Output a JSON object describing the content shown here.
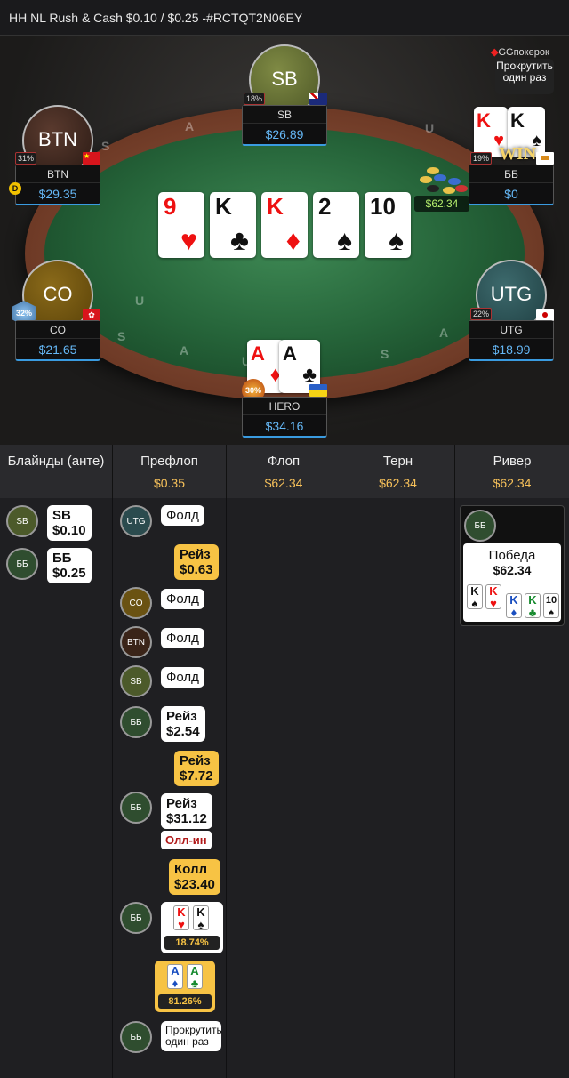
{
  "header": {
    "title": "HH NL Rush & Cash $0.10 / $0.25 -#RCTQT2N06EY"
  },
  "logo": {
    "brand": "GGпокерок"
  },
  "replay_button": {
    "label": "Прокрутить один раз"
  },
  "rail_letters": [
    "S",
    "A",
    "U",
    "S",
    "A",
    "U",
    "S",
    "A",
    "U"
  ],
  "players": {
    "sb": {
      "avatar": "SB",
      "name": "SB",
      "stack": "$26.89",
      "pct": "18%"
    },
    "btn": {
      "avatar": "BTN",
      "name": "BTN",
      "stack": "$29.35",
      "pct": "31%"
    },
    "bb": {
      "name": "ББ",
      "stack": "$0",
      "pct": "19%",
      "win": "WIN"
    },
    "co": {
      "avatar": "CO",
      "name": "CO",
      "stack": "$21.65",
      "pct": "32%"
    },
    "utg": {
      "avatar": "UTG",
      "name": "UTG",
      "stack": "$18.99",
      "pct": "22%"
    },
    "hero": {
      "name": "HERO",
      "stack": "$34.16",
      "pct": "30%"
    }
  },
  "dealer_button": "D",
  "pot": "$62.34",
  "board": [
    {
      "rank": "9",
      "suit": "♥",
      "color": "red"
    },
    {
      "rank": "K",
      "suit": "♣",
      "color": "black"
    },
    {
      "rank": "K",
      "suit": "♦",
      "color": "red"
    },
    {
      "rank": "2",
      "suit": "♠",
      "color": "black"
    },
    {
      "rank": "10",
      "suit": "♠",
      "color": "black"
    }
  ],
  "hero_cards": [
    {
      "rank": "A",
      "suit": "♦",
      "color": "red"
    },
    {
      "rank": "A",
      "suit": "♣",
      "color": "black"
    }
  ],
  "bb_cards": [
    {
      "rank": "K",
      "suit": "♥",
      "color": "red"
    },
    {
      "rank": "K",
      "suit": "♠",
      "color": "black"
    }
  ],
  "columns": [
    {
      "title": "Блайнды (анте)",
      "pot": ""
    },
    {
      "title": "Префлоп",
      "pot": "$0.35"
    },
    {
      "title": "Флоп",
      "pot": "$62.34"
    },
    {
      "title": "Терн",
      "pot": "$62.34"
    },
    {
      "title": "Ривер",
      "pot": "$62.34"
    }
  ],
  "blinds": [
    {
      "pos": "SB",
      "action": "SB",
      "amount": "$0.10"
    },
    {
      "pos": "ББ",
      "action": "ББ",
      "amount": "$0.25"
    }
  ],
  "preflop": {
    "a1": {
      "pos": "UTG",
      "action": "Фолд"
    },
    "a2": {
      "action": "Рейз",
      "amount": "$0.63"
    },
    "a3": {
      "pos": "CO",
      "action": "Фолд"
    },
    "a4": {
      "pos": "BTN",
      "action": "Фолд"
    },
    "a5": {
      "pos": "SB",
      "action": "Фолд"
    },
    "a6": {
      "pos": "ББ",
      "action": "Рейз",
      "amount": "$2.54"
    },
    "a7": {
      "action": "Рейз",
      "amount": "$7.72"
    },
    "a8": {
      "pos": "ББ",
      "action": "Рейз",
      "amount": "$31.12",
      "allin": "Олл-ин"
    },
    "a9": {
      "action": "Колл",
      "amount": "$23.40"
    },
    "eq_villain": {
      "pos": "ББ",
      "cards": [
        {
          "rank": "K",
          "suit": "♥",
          "color": "red"
        },
        {
          "rank": "K",
          "suit": "♠",
          "color": "black"
        }
      ],
      "equity": "18.74%"
    },
    "eq_hero": {
      "cards": [
        {
          "rank": "A",
          "suit": "♦",
          "color": "blue"
        },
        {
          "rank": "A",
          "suit": "♣",
          "color": "green"
        }
      ],
      "equity": "81.26%"
    },
    "a10": {
      "pos": "ББ",
      "action": "Прокрутить один раз"
    }
  },
  "river": {
    "pos": "ББ",
    "result": "Победа",
    "amount": "$62.34",
    "hole": [
      {
        "rank": "K",
        "suit": "♠",
        "color": "black"
      },
      {
        "rank": "K",
        "suit": "♥",
        "color": "red"
      }
    ],
    "board": [
      {
        "rank": "K",
        "suit": "♦",
        "color": "blue"
      },
      {
        "rank": "K",
        "suit": "♣",
        "color": "green"
      },
      {
        "rank": "10",
        "suit": "♠",
        "color": "black"
      }
    ]
  }
}
